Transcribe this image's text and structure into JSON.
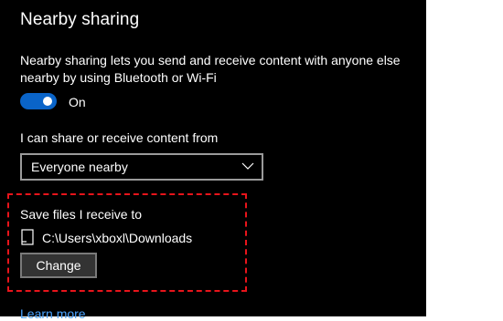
{
  "title": "Nearby sharing",
  "description": "Nearby sharing lets you send and receive content with anyone else nearby by using Bluetooth or Wi-Fi",
  "toggle": {
    "state_label": "On",
    "is_on": true,
    "color": "#0a64c8"
  },
  "share_from": {
    "label": "I can share or receive content from",
    "selected": "Everyone nearby",
    "icon": "chevron-down-icon"
  },
  "save_location": {
    "label": "Save files I receive to",
    "path": "C:\\Users\\xboxl\\Downloads",
    "icon": "folder-icon",
    "change_label": "Change",
    "highlight_color": "#e8141b"
  },
  "learn_more": "Learn more"
}
